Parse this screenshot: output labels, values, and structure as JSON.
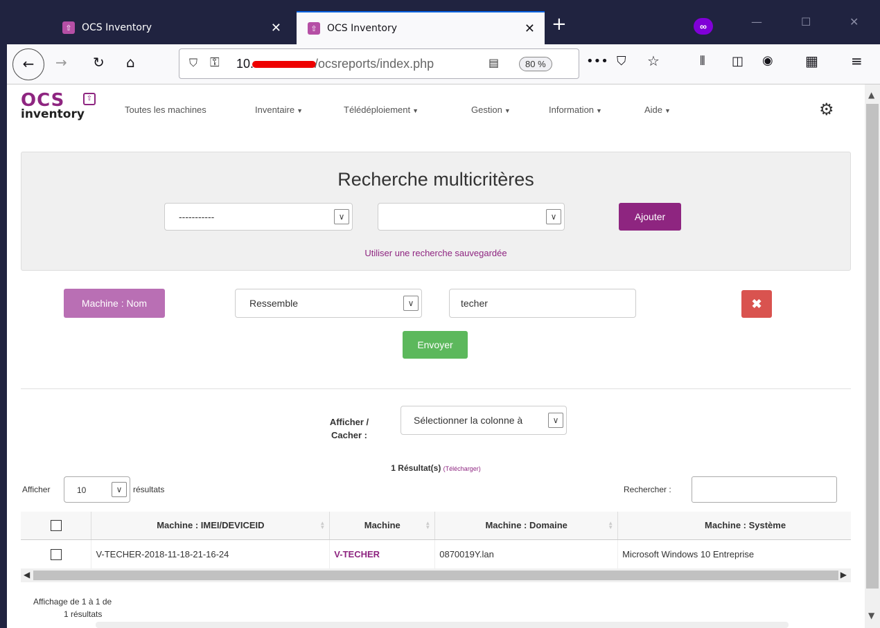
{
  "browser": {
    "tabs": [
      {
        "title": "OCS Inventory",
        "active": false
      },
      {
        "title": "OCS Inventory",
        "active": true
      }
    ],
    "url_prefix": "10.",
    "url_suffix": "/ocsreports/index.php",
    "zoom": "80 %"
  },
  "app": {
    "logo_top": "OCS",
    "logo_bottom": "inventory",
    "menu": [
      {
        "label": "Toutes les machines",
        "has_dropdown": false
      },
      {
        "label": "Inventaire",
        "has_dropdown": true
      },
      {
        "label": "Télédéploiement",
        "has_dropdown": true
      },
      {
        "label": "Gestion",
        "has_dropdown": true
      },
      {
        "label": "Information",
        "has_dropdown": true
      },
      {
        "label": "Aide",
        "has_dropdown": true
      }
    ]
  },
  "search": {
    "title": "Recherche multicritères",
    "field_select_value": "-----------",
    "operator_select_value": "",
    "add_button": "Ajouter",
    "saved_search_link": "Utiliser une recherche sauvegardée",
    "criterion": {
      "field_label": "Machine : Nom",
      "operator": "Ressemble",
      "value": "techer"
    },
    "submit_button": "Envoyer"
  },
  "results": {
    "column_picker_label": "Afficher / Cacher :",
    "column_picker_value": "Sélectionner la colonne à",
    "count_text": "1 Résultat(s)",
    "download_link": "(Télécharger)",
    "page_length_prefix": "Afficher",
    "page_length_value": "10",
    "page_length_suffix": "résultats",
    "filter_label": "Rechercher :",
    "filter_value": "",
    "columns": [
      "Machine : IMEI/DEVICEID",
      "Machine",
      "Machine : Domaine",
      "Machine : Système"
    ],
    "rows": [
      {
        "deviceid": "V-TECHER-2018-11-18-21-16-24",
        "machine": "V-TECHER",
        "domain": "0870019Y.lan",
        "system": "Microsoft Windows 10 Entreprise"
      }
    ],
    "info_line1": "Affichage de 1 à 1 de",
    "info_line2": "1 résultats"
  },
  "colors": {
    "brand": "#8e2580",
    "criterion_button": "#b96fb4",
    "success": "#5cb85c",
    "danger": "#d9534f"
  }
}
